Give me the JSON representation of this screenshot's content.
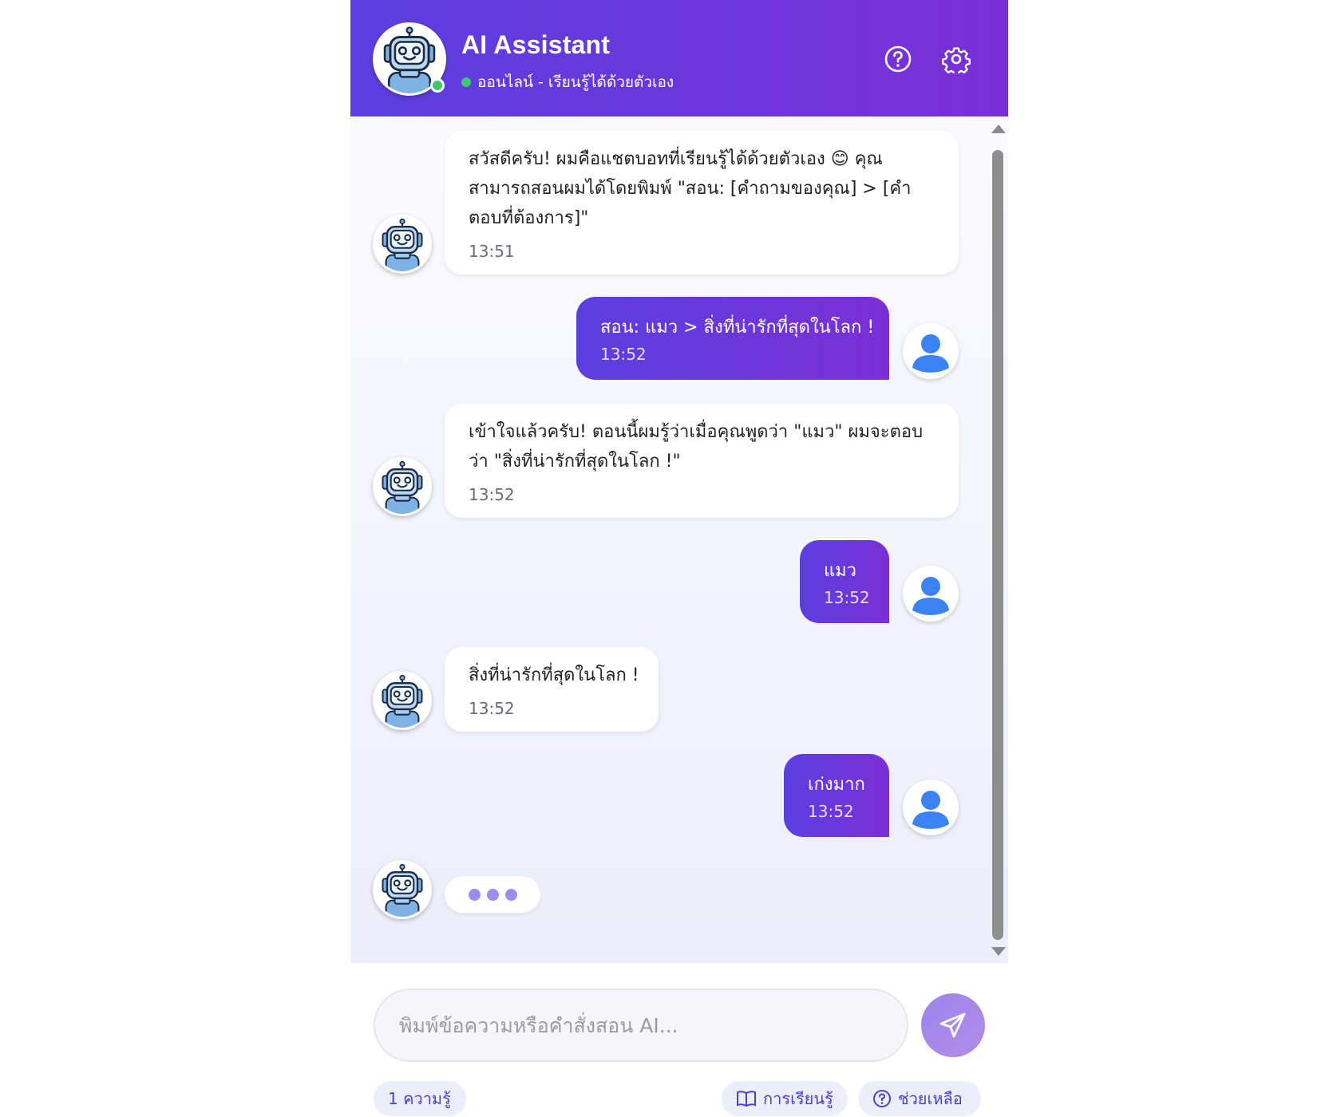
{
  "header": {
    "title": "AI Assistant",
    "status": "ออนไลน์ - เรียนรู้ได้ด้วยตัวเอง",
    "help_icon": "help-circle-icon",
    "settings_icon": "gear-icon"
  },
  "messages": [
    {
      "sender": "bot",
      "lines": [
        "สวัสดีครับ! ผมคือแชตบอทที่เรียนรู้ได้ด้วยตัวเอง 😊 คุณ",
        "สามารถสอนผมได้โดยพิมพ์ \"สอน: [คำถามของคุณ] > [คำ",
        "ตอบที่ต้องการ]\""
      ],
      "time": "13:51"
    },
    {
      "sender": "user",
      "lines": [
        "สอน: แมว > สิ่งที่น่ารักที่สุดในโลก !"
      ],
      "time": "13:52"
    },
    {
      "sender": "bot",
      "lines": [
        "เข้าใจแล้วครับ! ตอนนี้ผมรู้ว่าเมื่อคุณพูดว่า \"แมว\" ผมจะตอบ",
        "ว่า \"สิ่งที่น่ารักที่สุดในโลก !\""
      ],
      "time": "13:52"
    },
    {
      "sender": "user",
      "lines": [
        "แมว"
      ],
      "time": "13:52"
    },
    {
      "sender": "bot",
      "lines": [
        "สิ่งที่น่ารักที่สุดในโลก !"
      ],
      "time": "13:52"
    },
    {
      "sender": "user",
      "lines": [
        "เก่งมาก"
      ],
      "time": "13:52"
    }
  ],
  "composer": {
    "placeholder": "พิมพ์ข้อความหรือคำสั่งสอน AI...",
    "send_icon": "send-icon"
  },
  "footer": {
    "knowledge_count": "1 ความรู้",
    "learning_label": "การเรียนรู้",
    "help_label": "ช่วยเหลือ"
  },
  "colors": {
    "accent_start": "#5b3fe0",
    "accent_end": "#7a2fd6",
    "online": "#3fc96b"
  }
}
